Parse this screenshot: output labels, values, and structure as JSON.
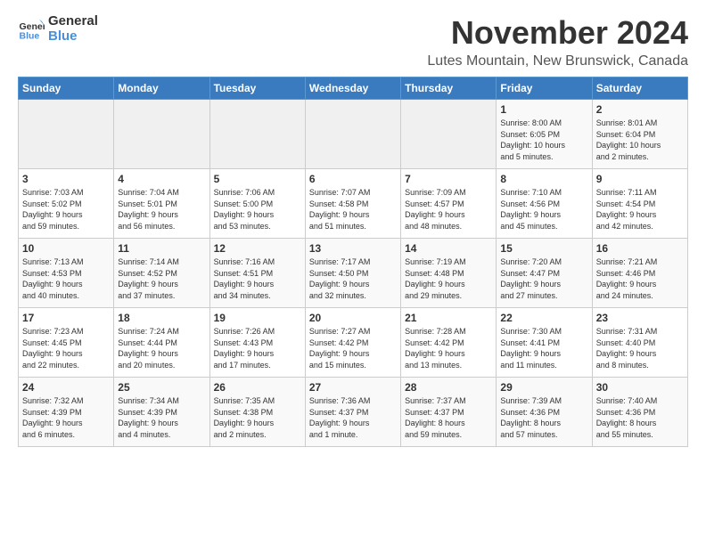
{
  "logo": {
    "line1": "General",
    "line2": "Blue"
  },
  "title": "November 2024",
  "subtitle": "Lutes Mountain, New Brunswick, Canada",
  "days_header": [
    "Sunday",
    "Monday",
    "Tuesday",
    "Wednesday",
    "Thursday",
    "Friday",
    "Saturday"
  ],
  "weeks": [
    [
      {
        "day": "",
        "info": ""
      },
      {
        "day": "",
        "info": ""
      },
      {
        "day": "",
        "info": ""
      },
      {
        "day": "",
        "info": ""
      },
      {
        "day": "",
        "info": ""
      },
      {
        "day": "1",
        "info": "Sunrise: 8:00 AM\nSunset: 6:05 PM\nDaylight: 10 hours\nand 5 minutes."
      },
      {
        "day": "2",
        "info": "Sunrise: 8:01 AM\nSunset: 6:04 PM\nDaylight: 10 hours\nand 2 minutes."
      }
    ],
    [
      {
        "day": "3",
        "info": "Sunrise: 7:03 AM\nSunset: 5:02 PM\nDaylight: 9 hours\nand 59 minutes."
      },
      {
        "day": "4",
        "info": "Sunrise: 7:04 AM\nSunset: 5:01 PM\nDaylight: 9 hours\nand 56 minutes."
      },
      {
        "day": "5",
        "info": "Sunrise: 7:06 AM\nSunset: 5:00 PM\nDaylight: 9 hours\nand 53 minutes."
      },
      {
        "day": "6",
        "info": "Sunrise: 7:07 AM\nSunset: 4:58 PM\nDaylight: 9 hours\nand 51 minutes."
      },
      {
        "day": "7",
        "info": "Sunrise: 7:09 AM\nSunset: 4:57 PM\nDaylight: 9 hours\nand 48 minutes."
      },
      {
        "day": "8",
        "info": "Sunrise: 7:10 AM\nSunset: 4:56 PM\nDaylight: 9 hours\nand 45 minutes."
      },
      {
        "day": "9",
        "info": "Sunrise: 7:11 AM\nSunset: 4:54 PM\nDaylight: 9 hours\nand 42 minutes."
      }
    ],
    [
      {
        "day": "10",
        "info": "Sunrise: 7:13 AM\nSunset: 4:53 PM\nDaylight: 9 hours\nand 40 minutes."
      },
      {
        "day": "11",
        "info": "Sunrise: 7:14 AM\nSunset: 4:52 PM\nDaylight: 9 hours\nand 37 minutes."
      },
      {
        "day": "12",
        "info": "Sunrise: 7:16 AM\nSunset: 4:51 PM\nDaylight: 9 hours\nand 34 minutes."
      },
      {
        "day": "13",
        "info": "Sunrise: 7:17 AM\nSunset: 4:50 PM\nDaylight: 9 hours\nand 32 minutes."
      },
      {
        "day": "14",
        "info": "Sunrise: 7:19 AM\nSunset: 4:48 PM\nDaylight: 9 hours\nand 29 minutes."
      },
      {
        "day": "15",
        "info": "Sunrise: 7:20 AM\nSunset: 4:47 PM\nDaylight: 9 hours\nand 27 minutes."
      },
      {
        "day": "16",
        "info": "Sunrise: 7:21 AM\nSunset: 4:46 PM\nDaylight: 9 hours\nand 24 minutes."
      }
    ],
    [
      {
        "day": "17",
        "info": "Sunrise: 7:23 AM\nSunset: 4:45 PM\nDaylight: 9 hours\nand 22 minutes."
      },
      {
        "day": "18",
        "info": "Sunrise: 7:24 AM\nSunset: 4:44 PM\nDaylight: 9 hours\nand 20 minutes."
      },
      {
        "day": "19",
        "info": "Sunrise: 7:26 AM\nSunset: 4:43 PM\nDaylight: 9 hours\nand 17 minutes."
      },
      {
        "day": "20",
        "info": "Sunrise: 7:27 AM\nSunset: 4:42 PM\nDaylight: 9 hours\nand 15 minutes."
      },
      {
        "day": "21",
        "info": "Sunrise: 7:28 AM\nSunset: 4:42 PM\nDaylight: 9 hours\nand 13 minutes."
      },
      {
        "day": "22",
        "info": "Sunrise: 7:30 AM\nSunset: 4:41 PM\nDaylight: 9 hours\nand 11 minutes."
      },
      {
        "day": "23",
        "info": "Sunrise: 7:31 AM\nSunset: 4:40 PM\nDaylight: 9 hours\nand 8 minutes."
      }
    ],
    [
      {
        "day": "24",
        "info": "Sunrise: 7:32 AM\nSunset: 4:39 PM\nDaylight: 9 hours\nand 6 minutes."
      },
      {
        "day": "25",
        "info": "Sunrise: 7:34 AM\nSunset: 4:39 PM\nDaylight: 9 hours\nand 4 minutes."
      },
      {
        "day": "26",
        "info": "Sunrise: 7:35 AM\nSunset: 4:38 PM\nDaylight: 9 hours\nand 2 minutes."
      },
      {
        "day": "27",
        "info": "Sunrise: 7:36 AM\nSunset: 4:37 PM\nDaylight: 9 hours\nand 1 minute."
      },
      {
        "day": "28",
        "info": "Sunrise: 7:37 AM\nSunset: 4:37 PM\nDaylight: 8 hours\nand 59 minutes."
      },
      {
        "day": "29",
        "info": "Sunrise: 7:39 AM\nSunset: 4:36 PM\nDaylight: 8 hours\nand 57 minutes."
      },
      {
        "day": "30",
        "info": "Sunrise: 7:40 AM\nSunset: 4:36 PM\nDaylight: 8 hours\nand 55 minutes."
      }
    ]
  ]
}
